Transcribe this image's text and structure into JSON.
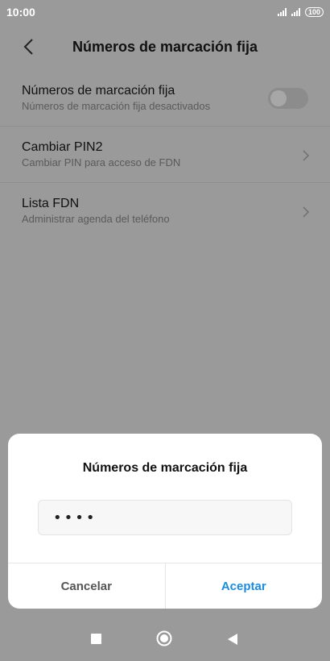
{
  "status_bar": {
    "time": "10:00",
    "battery": "100"
  },
  "app_bar": {
    "title": "Números de marcación fija"
  },
  "settings": [
    {
      "title": "Números de marcación fija",
      "subtitle": "Números de marcación fija desactivados",
      "control": "toggle",
      "enabled": false
    },
    {
      "title": "Cambiar PIN2",
      "subtitle": "Cambiar PIN para acceso de FDN",
      "control": "chevron"
    },
    {
      "title": "Lista FDN",
      "subtitle": "Administrar agenda del teléfono",
      "control": "chevron"
    }
  ],
  "dialog": {
    "title": "Números de marcación fija",
    "pin_value": "••••",
    "cancel_label": "Cancelar",
    "accept_label": "Aceptar"
  },
  "colors": {
    "accent": "#1a8de0",
    "scrim": "#9a9a9a",
    "dialog_bg": "#ffffff"
  },
  "icons": {
    "back": "chevron-left-icon",
    "row": "chevron-right-icon",
    "nav": [
      "recents-square-icon",
      "home-circle-icon",
      "back-triangle-icon"
    ]
  }
}
